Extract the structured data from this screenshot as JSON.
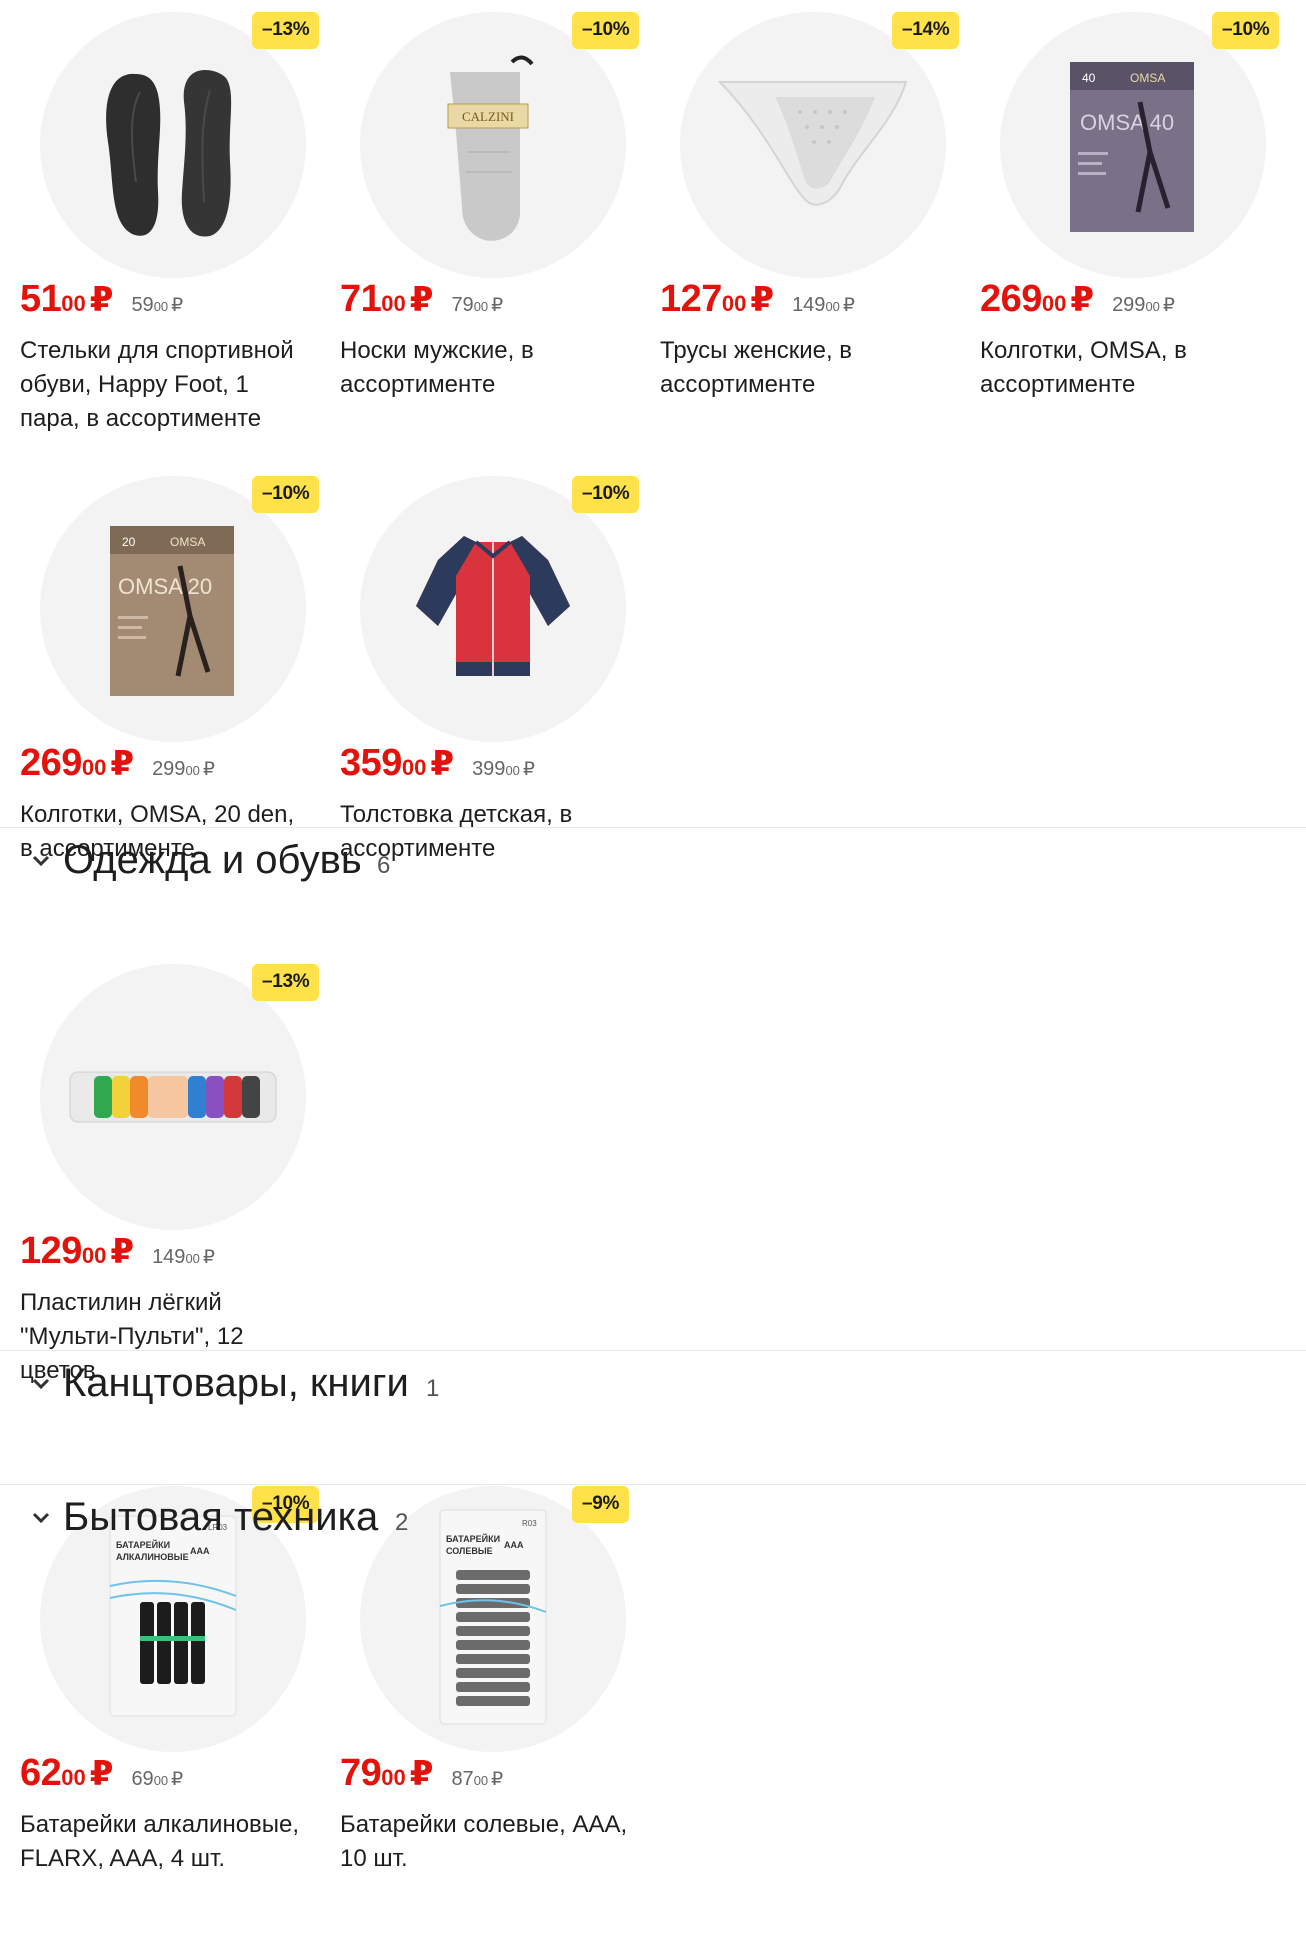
{
  "colors": {
    "price": "#e3120b",
    "badge": "#ffe24a",
    "circle": "#f3f3f3"
  },
  "products": [
    {
      "discount": "–13%",
      "price_int": "51",
      "price_cents": "00",
      "currency": "₽",
      "old_int": "59",
      "old_cents": "00",
      "title": "Стельки для спортивной обуви, Happy Foot, 1 пара, в ассортименте",
      "image": "insoles-image"
    },
    {
      "discount": "–10%",
      "price_int": "71",
      "price_cents": "00",
      "currency": "₽",
      "old_int": "79",
      "old_cents": "00",
      "title": "Носки мужские, в ассортименте",
      "image": "sock-image"
    },
    {
      "discount": "–14%",
      "price_int": "127",
      "price_cents": "00",
      "currency": "₽",
      "old_int": "149",
      "old_cents": "00",
      "title": "Трусы женские, в ассортименте",
      "image": "underwear-image"
    },
    {
      "discount": "–10%",
      "price_int": "269",
      "price_cents": "00",
      "currency": "₽",
      "old_int": "299",
      "old_cents": "00",
      "title": "Колготки, OMSA, в ассортименте",
      "image": "tights-image"
    },
    {
      "discount": "–10%",
      "price_int": "269",
      "price_cents": "00",
      "currency": "₽",
      "old_int": "299",
      "old_cents": "00",
      "title": "Колготки, OMSA, 20 den, в ассортименте",
      "image": "tights-image"
    },
    {
      "discount": "–10%",
      "price_int": "359",
      "price_cents": "00",
      "currency": "₽",
      "old_int": "399",
      "old_cents": "00",
      "title": "Толстовка детская, в ассортименте",
      "image": "sweatshirt-image"
    },
    {
      "discount": "–13%",
      "price_int": "129",
      "price_cents": "00",
      "currency": "₽",
      "old_int": "149",
      "old_cents": "00",
      "title": "Пластилин лёгкий \"Мульти-Пульти\", 12 цветов",
      "image": "plasticine-image"
    },
    {
      "discount": "–10%",
      "price_int": "62",
      "price_cents": "00",
      "currency": "₽",
      "old_int": "69",
      "old_cents": "00",
      "title": "Батарейки алкалиновые, FLARX, AAA, 4 шт.",
      "image": "batteries-image"
    },
    {
      "discount": "–9%",
      "price_int": "79",
      "price_cents": "00",
      "currency": "₽",
      "old_int": "87",
      "old_cents": "00",
      "title": "Батарейки солевые, AAA, 10 шт.",
      "image": "batteries-image"
    }
  ],
  "sections": [
    {
      "name": "Одежда и обувь",
      "count": "6"
    },
    {
      "name": "Канцтовары, книги",
      "count": "1"
    },
    {
      "name": "Бытовая техника",
      "count": "2"
    }
  ],
  "package_text": {
    "calzini": "CALZINI",
    "omsa_brand": "OMSA",
    "omsa40_label": "OMSA 40",
    "omsa40_den": "40",
    "omsa20_label": "OMSA 20",
    "omsa20_den": "20",
    "alkaline_line1": "БАТАРЕЙКИ",
    "alkaline_line2": "АЛКАЛИНОВЫЕ",
    "alkaline_aaa": "AAA",
    "alkaline_model": "LR03",
    "salt_line1": "БАТАРЕЙКИ",
    "salt_line2": "СОЛЕВЫЕ",
    "salt_aaa": "AAA",
    "salt_model": "R03"
  }
}
